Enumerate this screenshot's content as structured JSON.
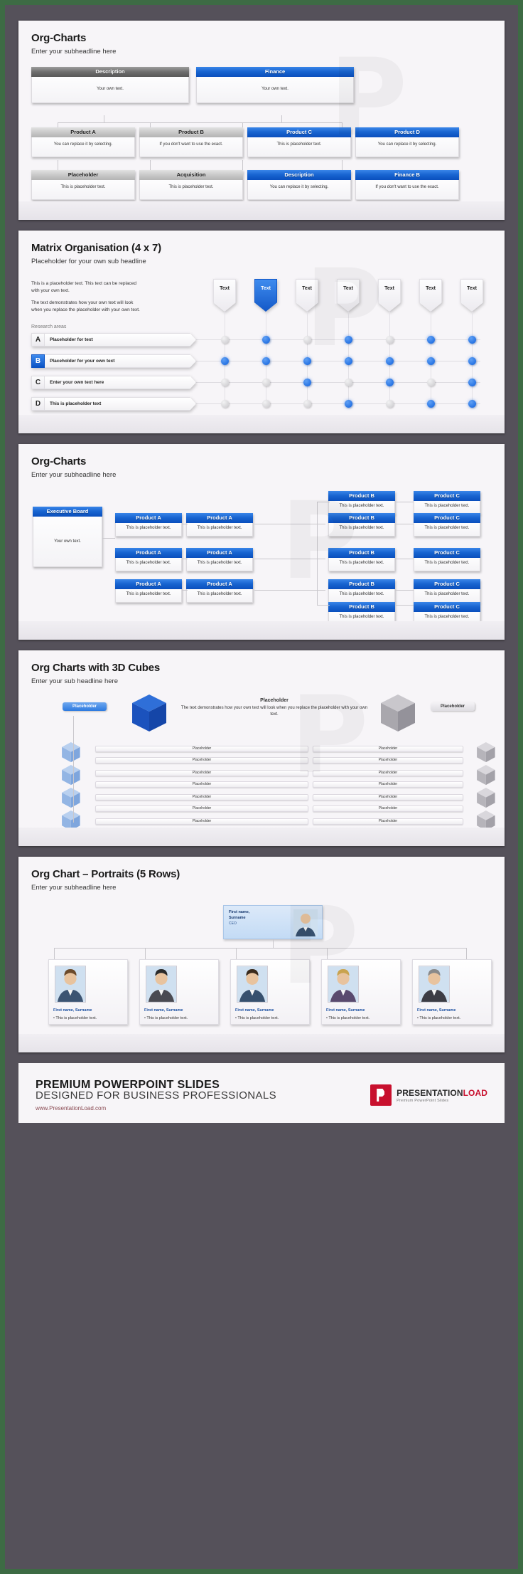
{
  "slides": [
    {
      "id": "org-charts-1",
      "title": "Org-Charts",
      "subtitle": "Enter your subheadline here",
      "row1": [
        {
          "head": "Description",
          "body": "Your own text.",
          "style": "gray"
        },
        {
          "head": "Finance",
          "body": "Your own text.",
          "style": "blue"
        }
      ],
      "row2": [
        {
          "head": "Product A",
          "body": "You can replace it by selecting.",
          "style": "gray2"
        },
        {
          "head": "Product B",
          "body": "If you don't want to use the exact.",
          "style": "gray2"
        },
        {
          "head": "Product C",
          "body": "This is placeholder text.",
          "style": "blue"
        },
        {
          "head": "Product D",
          "body": "You can replace it by selecting.",
          "style": "blue"
        }
      ],
      "row3": [
        {
          "head": "Placeholder",
          "body": "This is placeholder text.",
          "style": "gray2"
        },
        {
          "head": "Acquisition",
          "body": "This is placeholder text.",
          "style": "gray2"
        },
        {
          "head": "Description",
          "body": "You can replace it by selecting.",
          "style": "blue"
        },
        {
          "head": "Finance B",
          "body": "If you don't want to use the exact.",
          "style": "blue"
        }
      ]
    },
    {
      "id": "matrix-organisation",
      "title": "Matrix Organisation (4 x 7)",
      "subtitle": "Placeholder for your own sub headline",
      "paragraph1": "This is a placeholder text. This text can be replaced with your own text.",
      "paragraph2": "The text demonstrates how your own text will look when you replace the placeholder with your own text.",
      "research_label": "Research areas",
      "rows": [
        {
          "letter": "A",
          "label": "Placeholder for text",
          "active": false
        },
        {
          "letter": "B",
          "label": "Placeholder for your own text",
          "active": true
        },
        {
          "letter": "C",
          "label": "Enter your own text here",
          "active": false
        },
        {
          "letter": "D",
          "label": "This is placeholder text",
          "active": false
        }
      ],
      "columns": [
        {
          "label": "Text",
          "active": false
        },
        {
          "label": "Text",
          "active": true
        },
        {
          "label": "Text",
          "active": false
        },
        {
          "label": "Text",
          "active": false
        },
        {
          "label": "Text",
          "active": false
        },
        {
          "label": "Text",
          "active": false
        },
        {
          "label": "Text",
          "active": false
        }
      ],
      "matrix": [
        [
          0,
          1,
          0,
          1,
          0,
          1,
          1
        ],
        [
          1,
          1,
          1,
          1,
          1,
          1,
          1
        ],
        [
          0,
          0,
          1,
          0,
          1,
          0,
          1
        ],
        [
          0,
          0,
          0,
          1,
          0,
          1,
          1
        ]
      ]
    },
    {
      "id": "org-charts-2",
      "title": "Org-Charts",
      "subtitle": "Enter your subheadline here",
      "root": {
        "head": "Executive Board",
        "body": "Your own text."
      },
      "col_a": [
        {
          "head": "Product A",
          "body": "This is placeholder text."
        },
        {
          "head": "Product A",
          "body": "This is placeholder text."
        },
        {
          "head": "Product A",
          "body": "This is placeholder text."
        }
      ],
      "col_b": [
        {
          "head": "Product A",
          "body": "This is placeholder text."
        },
        {
          "head": "Product A",
          "body": "This is placeholder text."
        },
        {
          "head": "Product A",
          "body": "This is placeholder text."
        }
      ],
      "col_c": [
        {
          "head": "Product B",
          "body": "This is placeholder text."
        },
        {
          "head": "Product B",
          "body": "This is placeholder text."
        },
        {
          "head": "Product B",
          "body": "This is placeholder text."
        },
        {
          "head": "Product B",
          "body": "This is placeholder text."
        },
        {
          "head": "Product B",
          "body": "This is placeholder text."
        }
      ],
      "col_d": [
        {
          "head": "Product C",
          "body": "This is placeholder text."
        },
        {
          "head": "Product C",
          "body": "This is placeholder text."
        },
        {
          "head": "Product C",
          "body": "This is placeholder text."
        },
        {
          "head": "Product C",
          "body": "This is placeholder text."
        },
        {
          "head": "Product C",
          "body": "This is placeholder text."
        }
      ]
    },
    {
      "id": "org-charts-3d-cubes",
      "title": "Org Charts with 3D Cubes",
      "subtitle": "Enter your sub headline here",
      "left_pill": "Placeholder",
      "right_pill": "Placeholder",
      "center_title": "Placeholder",
      "center_text": "The text demonstrates how your own text will look when you replace the placeholder with your own text.",
      "bar_label": "Placeholder",
      "left_bars": 8,
      "right_bars": 8
    },
    {
      "id": "org-chart-portraits",
      "title": "Org Chart – Portraits (5 Rows)",
      "subtitle": "Enter your subheadline here",
      "ceo": {
        "line1": "First name,",
        "line2": "Surname",
        "line3": "CEO"
      },
      "people": [
        {
          "name": "First name, Surname",
          "text": "This is placeholder text."
        },
        {
          "name": "First name, Surname",
          "text": "This is placeholder text."
        },
        {
          "name": "First name, Surname",
          "text": "This is placeholder text."
        },
        {
          "name": "First name, Surname",
          "text": "This is placeholder text."
        },
        {
          "name": "First name, Surname",
          "text": "This is placeholder text."
        }
      ]
    }
  ],
  "footer": {
    "line1": "PREMIUM POWERPOINT SLIDES",
    "line2": "DESIGNED FOR BUSINESS PROFESSIONALS",
    "url": "www.PresentationLoad.com",
    "brand_name_1": "PRESENTATION",
    "brand_name_2": "LOAD",
    "brand_tagline": "Premium PowerPoint Slides"
  },
  "colors": {
    "accent_blue": "#1763cf",
    "brand_red": "#c8102e",
    "frame_green": "#3d6b44",
    "page_bg": "#55515a"
  }
}
